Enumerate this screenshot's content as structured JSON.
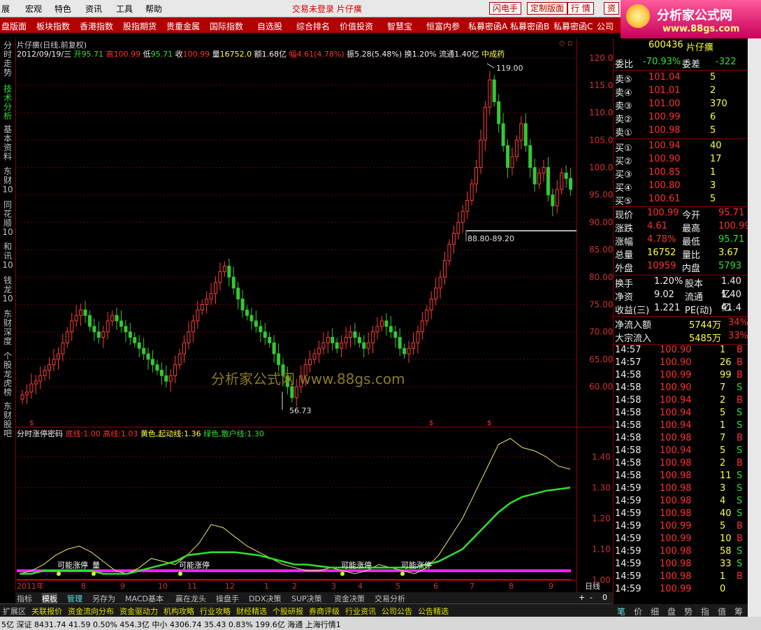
{
  "menu": {
    "items": [
      "展",
      "宏观",
      "特色",
      "资讯",
      "工具",
      "帮助"
    ],
    "center": "交易未登录  片仔癀",
    "buttons": [
      "闪电手",
      "定制版面",
      "行  情",
      "资"
    ]
  },
  "logo": {
    "title": "分析家公式网",
    "url": "www.88gs.com"
  },
  "nav": {
    "items": [
      "盘版面",
      "板块指数",
      "香港指数",
      "股指期货",
      "贵重金属",
      "国际指数",
      "自选股",
      "综合排名",
      "价值投资",
      "智慧宝",
      "恒富内参",
      "私募密函A",
      "私募密函B",
      "私募密函C",
      "公司"
    ]
  },
  "side_tabs": [
    "分时走势",
    "技术分析",
    "基本资料",
    "东财10",
    "同花顺10",
    "和讯10",
    "钱龙10",
    "东财深度",
    "个股龙虎榜",
    "东财股吧"
  ],
  "chart_header": {
    "title": "片仔癀(日线,前复权)",
    "date": "2012/09/19/三",
    "open_l": "开",
    "open": "95.71",
    "high_l": "高",
    "high": "100.99",
    "low_l": "低",
    "low": "95.71",
    "close_l": "收",
    "close": "100.99",
    "vol_l": "量",
    "vol": "16752.0",
    "amt_l": "额",
    "amt": "1.68亿",
    "chg_l": "幅",
    "chg": "4.61(4.78%)",
    "amp": "振5.28(5.48%)",
    "turn": "换1.20%",
    "float": "流通1.40亿",
    "sector": "中成药"
  },
  "chart_data": [
    {
      "type": "candlestick",
      "title": "片仔癀(日线,前复权)",
      "y_ticks": [
        "120.00",
        "115.00",
        "110.00",
        "105.00",
        "100.0",
        "95.00",
        "90.00",
        "85.00",
        "80.00",
        "75.00",
        "70.00",
        "65.00",
        "60.00"
      ],
      "ylim": [
        54,
        121
      ],
      "x_ticks": [
        "2011年",
        "8",
        "9",
        "10",
        "11",
        "12",
        "1",
        "2",
        "3",
        "4",
        "5",
        "6",
        "7",
        "8",
        "9"
      ],
      "annotations": {
        "high": "119.00",
        "low": "56.73",
        "range": "88.80-89.20"
      },
      "close_series": [
        58.5,
        59,
        60.5,
        61,
        62,
        63,
        64,
        65,
        66,
        68,
        70,
        72,
        73,
        74,
        73,
        71,
        70,
        69,
        70,
        72,
        73,
        72,
        71,
        70,
        69,
        68,
        67,
        66,
        65,
        64,
        63,
        62,
        61,
        62,
        64,
        66,
        68,
        70,
        72,
        74,
        75,
        76,
        77,
        79,
        81,
        82,
        80,
        78,
        76,
        74,
        73,
        72,
        71,
        70,
        69,
        68,
        66,
        64,
        62,
        60,
        58,
        60,
        62,
        64,
        65,
        66,
        67,
        68,
        69,
        68,
        67,
        68,
        69,
        70,
        69,
        68,
        67,
        68,
        70,
        71,
        72,
        71,
        70,
        69,
        67,
        66,
        67,
        68,
        70,
        72,
        74,
        76,
        78,
        80,
        83,
        86,
        88,
        90,
        92,
        94,
        97,
        100,
        105,
        111,
        116,
        112,
        108,
        104,
        100,
        102,
        105,
        108,
        104,
        100,
        97,
        99,
        100,
        95,
        93,
        96,
        99,
        98,
        96
      ],
      "watermark": "分析家公式网 www.88gs.com"
    },
    {
      "type": "line",
      "title": "分时涨停密码",
      "legend": [
        {
          "label": "底线:",
          "value": "1.00"
        },
        {
          "label": "高线:",
          "value": "1.03"
        },
        {
          "label": "黄色,起动线:",
          "value": "1.36"
        },
        {
          "label": "绿色,散户线:",
          "value": "1.30"
        }
      ],
      "y_ticks": [
        "1.40",
        "1.30",
        "1.20",
        "1.10",
        "1.00"
      ],
      "ylim": [
        0.96,
        1.46
      ],
      "series": [
        {
          "name": "黄色,起动线",
          "color": "#e8e870",
          "values": [
            1.02,
            1.03,
            1.05,
            1.08,
            1.1,
            1.11,
            1.09,
            1.06,
            1.03,
            1.02,
            1.04,
            1.07,
            1.06,
            1.05,
            1.08,
            1.12,
            1.18,
            1.17,
            1.14,
            1.11,
            1.09,
            1.07,
            1.05,
            1.04,
            1.03,
            1.03,
            1.04,
            1.03,
            1.02,
            1.03,
            1.05,
            1.04,
            1.03,
            1.02,
            1.04,
            1.08,
            1.14,
            1.2,
            1.28,
            1.36,
            1.44,
            1.46,
            1.43,
            1.42,
            1.4,
            1.37,
            1.36
          ]
        },
        {
          "name": "绿色,散户线",
          "color": "#30e030",
          "values": [
            1.02,
            1.02,
            1.03,
            1.03,
            1.03,
            1.03,
            1.03,
            1.02,
            1.02,
            1.02,
            1.03,
            1.04,
            1.05,
            1.06,
            1.08,
            1.085,
            1.09,
            1.09,
            1.09,
            1.085,
            1.08,
            1.07,
            1.06,
            1.05,
            1.05,
            1.045,
            1.04,
            1.04,
            1.04,
            1.04,
            1.04,
            1.04,
            1.04,
            1.04,
            1.05,
            1.06,
            1.08,
            1.1,
            1.14,
            1.18,
            1.22,
            1.25,
            1.27,
            1.28,
            1.29,
            1.295,
            1.3
          ]
        }
      ],
      "labels": [
        "可能涨停",
        "量",
        "可能涨停",
        "可能涨停",
        "可能涨停"
      ]
    }
  ],
  "period_label": "日线",
  "right_panel": {
    "code": "600436",
    "name": "片仔癀",
    "weibi_l": "委比",
    "weibi": "-70.93%",
    "weicha_l": "委差",
    "weicha": "-322",
    "sells": [
      {
        "l": "卖⑤",
        "p": "101.04",
        "v": "5"
      },
      {
        "l": "卖④",
        "p": "101.01",
        "v": "2"
      },
      {
        "l": "卖③",
        "p": "101.00",
        "v": "370"
      },
      {
        "l": "卖②",
        "p": "100.99",
        "v": "6"
      },
      {
        "l": "卖①",
        "p": "100.98",
        "v": "5"
      }
    ],
    "buys": [
      {
        "l": "买①",
        "p": "100.94",
        "v": "40"
      },
      {
        "l": "买②",
        "p": "100.90",
        "v": "17"
      },
      {
        "l": "买③",
        "p": "100.85",
        "v": "1"
      },
      {
        "l": "买④",
        "p": "100.80",
        "v": "3"
      },
      {
        "l": "买⑤",
        "p": "100.61",
        "v": "5"
      }
    ],
    "stats": [
      {
        "l1": "现价",
        "v1": "100.99",
        "l2": "今开",
        "v2": "95.71"
      },
      {
        "l1": "涨跌",
        "v1": "4.61",
        "l2": "最高",
        "v2": "100.99"
      },
      {
        "l1": "涨幅",
        "v1": "4.78%",
        "l2": "最低",
        "v2": "95.71"
      },
      {
        "l1": "总量",
        "v1": "16752",
        "l2": "量比",
        "v2": "3.67"
      },
      {
        "l1": "外盘",
        "v1": "10959",
        "l2": "内盘",
        "v2": "5793"
      }
    ],
    "stats2": [
      {
        "l1": "换手",
        "v1": "1.20%",
        "l2": "股本",
        "v2": "1.40亿"
      },
      {
        "l1": "净资",
        "v1": "9.02",
        "l2": "流通",
        "v2": "1.40亿"
      },
      {
        "l1": "收益(三)",
        "v1": "1.221",
        "l2": "PE(动)",
        "v2": "41.4"
      }
    ],
    "flows": [
      {
        "l": "净流入额",
        "v": "5744万",
        "p": "34%"
      },
      {
        "l": "大宗流入",
        "v": "5485万",
        "p": "33%"
      }
    ],
    "ticks": [
      {
        "t": "14:57",
        "p": "100.90",
        "v": "1",
        "d": "B"
      },
      {
        "t": "14:57",
        "p": "100.90",
        "v": "26",
        "d": "B"
      },
      {
        "t": "14:58",
        "p": "100.99",
        "v": "99",
        "d": "B"
      },
      {
        "t": "14:58",
        "p": "100.90",
        "v": "7",
        "d": "S"
      },
      {
        "t": "14:58",
        "p": "100.94",
        "v": "2",
        "d": "B"
      },
      {
        "t": "14:58",
        "p": "100.94",
        "v": "5",
        "d": "S"
      },
      {
        "t": "14:58",
        "p": "100.94",
        "v": "1",
        "d": "S"
      },
      {
        "t": "14:58",
        "p": "100.98",
        "v": "7",
        "d": "B"
      },
      {
        "t": "14:58",
        "p": "100.94",
        "v": "5",
        "d": "S"
      },
      {
        "t": "14:58",
        "p": "100.98",
        "v": "2",
        "d": "B"
      },
      {
        "t": "14:58",
        "p": "100.98",
        "v": "11",
        "d": "S"
      },
      {
        "t": "14:59",
        "p": "100.98",
        "v": "3",
        "d": "S"
      },
      {
        "t": "14:59",
        "p": "100.98",
        "v": "4",
        "d": "S"
      },
      {
        "t": "14:59",
        "p": "100.98",
        "v": "40",
        "d": "S"
      },
      {
        "t": "14:59",
        "p": "100.99",
        "v": "5",
        "d": "B"
      },
      {
        "t": "14:59",
        "p": "100.99",
        "v": "10",
        "d": "B"
      },
      {
        "t": "14:59",
        "p": "100.98",
        "v": "58",
        "d": "S"
      },
      {
        "t": "14:59",
        "p": "100.98",
        "v": "33",
        "d": "S"
      },
      {
        "t": "14:59",
        "p": "100.98",
        "v": "1",
        "d": "B"
      },
      {
        "t": "14:59",
        "p": "100.99",
        "v": "0",
        "d": ""
      }
    ],
    "tabs": [
      "笔",
      "价",
      "细",
      "盘",
      "势",
      "指",
      "值",
      "筹"
    ]
  },
  "bottom_tabs": [
    "指标",
    "模板",
    "管理",
    "另存为",
    "MACD基本",
    "赢在龙头",
    "操盘手",
    "DDX决策",
    "SUP决策",
    "资金决策",
    "交易分析"
  ],
  "bottom_tabs2": [
    "扩展区",
    "关联报价",
    "资金流向分布",
    "资金驱动力",
    "机构攻略",
    "行业攻略",
    "财经精选",
    "个股研报",
    "券商评级",
    "行业资讯",
    "公司公告",
    "公告精选"
  ],
  "zoom": {
    "plus": "+",
    "minus": "-",
    "zero": "0"
  },
  "status": {
    "text": "5亿   深证 8431.74  41.59  0.50%   454.3亿    中小 4306.74  35.43  0.83%   199.6亿     海通 上海行情1"
  }
}
